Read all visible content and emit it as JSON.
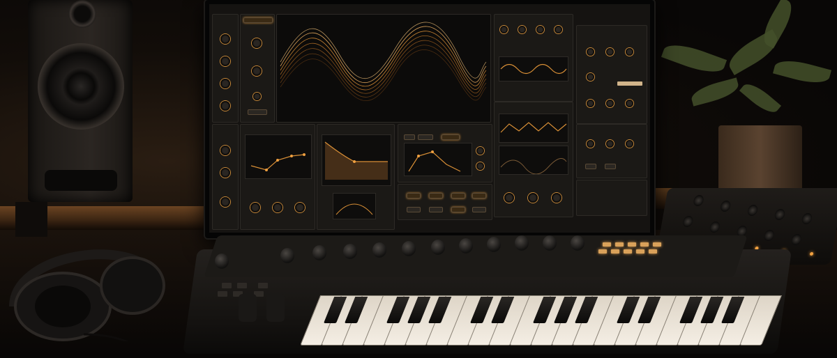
{
  "scene": {
    "accent_color": "#d89a4a",
    "description_tags": [
      "studio-monitor-speaker",
      "headphones",
      "computer-monitor",
      "synth-plugin-ui",
      "midi-keyboard",
      "midi-controller",
      "potted-plant"
    ]
  },
  "synth_ui": {
    "visible_text": []
  }
}
